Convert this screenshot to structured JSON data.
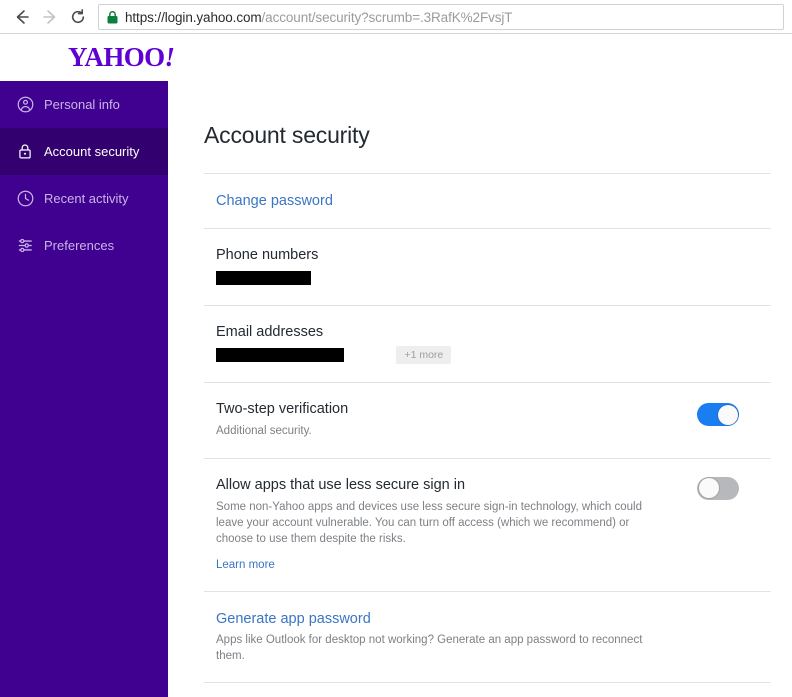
{
  "browser": {
    "back_icon": "back-arrow-icon",
    "forward_icon": "forward-arrow-icon",
    "reload_icon": "reload-icon",
    "lock_icon": "secure-lock-icon",
    "url_domain": "https://login.yahoo.com",
    "url_path": "/account/security?scrumb=.3RafK%2FvsjT",
    "url_full": "https://login.yahoo.com/account/security?scrumb=.3RafK%2FvsjT"
  },
  "brand": {
    "logo_text": "YAHOO",
    "logo_excl": "!",
    "logo_color": "#5f01d1"
  },
  "sidebar": {
    "background": "#400090",
    "active_background": "#32016f",
    "items": [
      {
        "label": "Personal info",
        "icon": "person-circle-icon",
        "active": false
      },
      {
        "label": "Account security",
        "icon": "lock-icon",
        "active": true
      },
      {
        "label": "Recent activity",
        "icon": "clock-icon",
        "active": false
      },
      {
        "label": "Preferences",
        "icon": "sliders-icon",
        "active": false
      }
    ]
  },
  "main": {
    "title": "Account security",
    "change_password_label": "Change password",
    "phone_section": {
      "title": "Phone numbers",
      "redacted_value": ""
    },
    "email_section": {
      "title": "Email addresses",
      "redacted_value": "",
      "more_badge": "+1 more"
    },
    "two_step": {
      "title": "Two-step verification",
      "subtitle": "Additional security.",
      "toggle_state": "on"
    },
    "less_secure": {
      "title": "Allow apps that use less secure sign in",
      "description": "Some non-Yahoo apps and devices use less secure sign-in technology, which could leave your account vulnerable. You can turn off access (which we recommend) or choose to use them despite the risks.",
      "learn_more_label": "Learn more",
      "toggle_state": "off"
    },
    "app_password": {
      "title": "Generate app password",
      "description": "Apps like Outlook for desktop not working? Generate an app password to reconnect them."
    }
  },
  "colors": {
    "link": "#3a75c4",
    "toggle_on": "#1a7ef0",
    "toggle_off": "#b6b8bb",
    "divider": "#e0e4e9"
  }
}
